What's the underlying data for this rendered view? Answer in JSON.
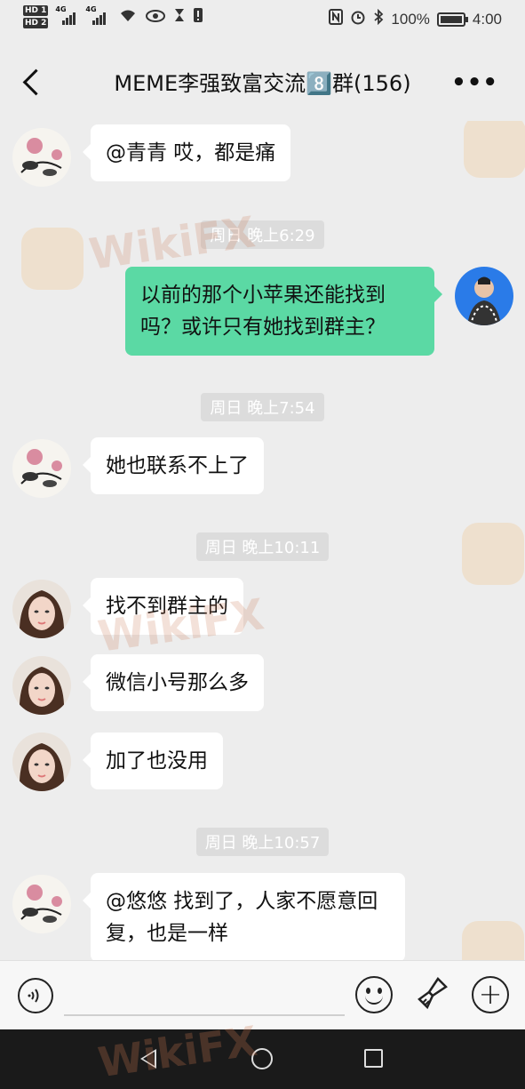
{
  "status_bar": {
    "hd1": "HD 1",
    "hd2": "HD 2",
    "net1": "4G",
    "net2": "4G",
    "battery_text": "100%",
    "time": "4:00"
  },
  "header": {
    "title": "MEME李强致富交流8️⃣群(156)",
    "more_label": "•••"
  },
  "messages": [
    {
      "side": "left",
      "text": "@青青 哎，都是痛",
      "avatar": "flower-painting"
    },
    {
      "side": "time",
      "text": "周日 晚上6:29"
    },
    {
      "side": "right",
      "text": "以前的那个小苹果还能找到吗？或许只有她找到群主？",
      "avatar": "man-photo"
    },
    {
      "side": "time",
      "text": "周日 晚上7:54"
    },
    {
      "side": "left",
      "text": "她也联系不上了",
      "avatar": "flower-painting"
    },
    {
      "side": "time",
      "text": "周日 晚上10:11"
    },
    {
      "side": "left",
      "text": "找不到群主的",
      "avatar": "woman-photo"
    },
    {
      "side": "left",
      "text": "微信小号那么多",
      "avatar": "woman-photo"
    },
    {
      "side": "left",
      "text": "加了也没用",
      "avatar": "woman-photo"
    },
    {
      "side": "time",
      "text": "周日 晚上10:57"
    },
    {
      "side": "left",
      "text": "@悠悠 找到了，人家不愿意回复，也是一样",
      "avatar": "flower-painting"
    }
  ],
  "watermark": "WikiFX"
}
